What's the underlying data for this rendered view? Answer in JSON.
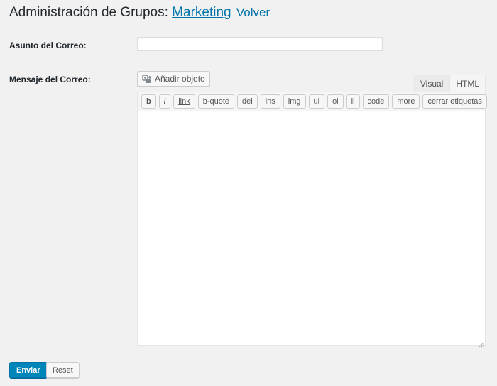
{
  "header": {
    "title_prefix": "Administración de Grupos:",
    "group_link": "Marketing",
    "back_link": "Volver"
  },
  "form": {
    "subject_label": "Asunto del Correo:",
    "subject_value": "",
    "message_label": "Mensaje del Correo:",
    "message_value": ""
  },
  "editor": {
    "add_media_label": "Añadir objeto",
    "tabs": [
      {
        "label": "Visual",
        "active": false
      },
      {
        "label": "HTML",
        "active": true
      }
    ],
    "quicktags": [
      "b",
      "i",
      "link",
      "b-quote",
      "del",
      "ins",
      "img",
      "ul",
      "ol",
      "li",
      "code",
      "more",
      "cerrar etiquetas"
    ]
  },
  "actions": {
    "submit_label": "Enviar",
    "reset_label": "Reset"
  },
  "colors": {
    "primary": "#0085ba",
    "link": "#0073aa",
    "background": "#f1f1f1"
  },
  "icons": {
    "add_media": "media-icon",
    "resize": "resize-grip-icon"
  }
}
